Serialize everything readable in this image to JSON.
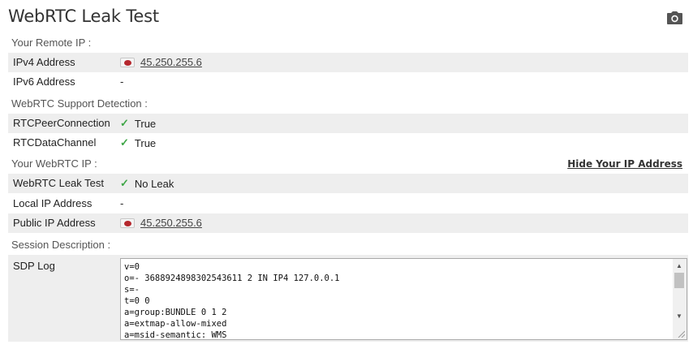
{
  "title": "WebRTC Leak Test",
  "sections": {
    "remote_ip": "Your Remote IP :",
    "support": "WebRTC Support Detection :",
    "webrtc_ip": "Your WebRTC IP :",
    "session": "Session Description :"
  },
  "rows": {
    "ipv4_label": "IPv4 Address",
    "ipv4_value": "45.250.255.6",
    "ipv6_label": "IPv6 Address",
    "ipv6_value": "-",
    "rtcpc_label": "RTCPeerConnection",
    "rtcpc_value": "True",
    "rtcdc_label": "RTCDataChannel",
    "rtcdc_value": "True",
    "leak_label": "WebRTC Leak Test",
    "leak_value": "No Leak",
    "local_label": "Local IP Address",
    "local_value": "-",
    "public_label": "Public IP Address",
    "public_value": "45.250.255.6"
  },
  "hide_link": "Hide Your IP Address",
  "sdp": {
    "label": "SDP Log",
    "text": "v=0\no=- 3688924898302543611 2 IN IP4 127.0.0.1\ns=-\nt=0 0\na=group:BUNDLE 0 1 2\na=extmap-allow-mixed\na=msid-semantic: WMS"
  },
  "icons": {
    "camera": "camera-icon",
    "flag": "flag-icon",
    "check": "check-icon"
  },
  "colors": {
    "check": "#3fa647",
    "flag_red": "#b5272d",
    "stripe": "#eeeeee"
  }
}
